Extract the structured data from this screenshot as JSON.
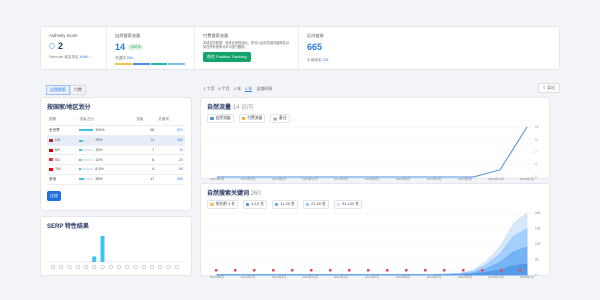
{
  "stats": {
    "authority": {
      "label": "Authority Score",
      "value": "2",
      "sub_prefix": "Semrush 域名排名",
      "sub_link": "6.6M ↑"
    },
    "organic": {
      "label": "自然搜索流量",
      "value": "14",
      "badge": "+267%",
      "sub_label": "关键词",
      "sub_value": "260 ↑",
      "bar_colors": [
        "#f5c24d",
        "#4a90e2",
        "#1fb8a9",
        "#7ac0f5"
      ]
    },
    "paid": {
      "label": "付费搜索流量",
      "desc": "本域名的数据，但未比较检测出，您可以启动关键词追踪并对其在所有竞争对手中进行跟踪。",
      "button": "前往 Position Tracking"
    },
    "backlinks": {
      "label": "反向链接",
      "value": "665",
      "sub_label": "引用域名",
      "sub_value": "235"
    }
  },
  "left_tabs": [
    "自然搜索",
    "付费"
  ],
  "country_panel": {
    "title": "按国家/地区划分",
    "headers": [
      "国家",
      "流量占比",
      "流量",
      "关键词"
    ],
    "rows": [
      {
        "flag": "",
        "country": "全世界",
        "share": "100%",
        "traffic": "48",
        "keywords": "531",
        "pct": 100,
        "hl": false,
        "flag_color": ""
      },
      {
        "flag": "US",
        "country": "US",
        "share": "29%",
        "traffic": "14",
        "keywords": "260",
        "pct": 29,
        "hl": true,
        "flag_color": "#b22234"
      },
      {
        "flag": "MY",
        "country": "MY",
        "share": "15%",
        "traffic": "7",
        "keywords": "11",
        "pct": 15,
        "hl": false,
        "flag_color": "#cc0001"
      },
      {
        "flag": "SG",
        "country": "SG",
        "share": "13%",
        "traffic": "6",
        "keywords": "20",
        "pct": 13,
        "hl": false,
        "flag_color": "#ef3340"
      },
      {
        "flag": "TW",
        "country": "TW",
        "share": "8.3%",
        "traffic": "4",
        "keywords": "84",
        "pct": 8,
        "hl": false,
        "flag_color": "#fe0000"
      },
      {
        "flag": "",
        "country": "其他",
        "share": "35%",
        "traffic": "17",
        "keywords": "255",
        "pct": 35,
        "hl": false,
        "flag_color": ""
      }
    ],
    "compare_btn": "比较"
  },
  "serp_panel": {
    "title": "SERP 特性结果",
    "bars": [
      0,
      0,
      0,
      0,
      0,
      3,
      14,
      0,
      0,
      0,
      0,
      0,
      0,
      0,
      0,
      0
    ]
  },
  "periods": [
    "1 个月",
    "6 个月",
    "1 年",
    "2 年",
    "全部时间"
  ],
  "period_active": 3,
  "export_label": "导出",
  "traffic_chart": {
    "title": "自然流量",
    "count": "14 访问",
    "legend": [
      {
        "label": "自然流量",
        "color": "#4a90e2"
      },
      {
        "label": "付费流量",
        "color": "#f5a623"
      },
      {
        "label": "备注",
        "color": ""
      }
    ],
    "x_labels": [
      "2023年5月",
      "2023年7月",
      "2023年9月",
      "2023年11月",
      "2024年1月",
      "2024年3月",
      "2024年5月",
      "2024年7月",
      "2024年9月",
      "2024年11月",
      "2025年1月"
    ],
    "y_labels": [
      "14",
      "11",
      "7",
      "4",
      "0"
    ],
    "values": [
      0,
      0,
      0,
      0,
      0,
      0,
      0,
      0,
      0,
      0,
      0,
      0,
      0,
      0,
      0,
      0,
      0,
      0,
      0,
      0,
      1,
      2,
      8,
      14
    ]
  },
  "keywords_chart": {
    "title": "自然搜索关键词",
    "count": "260",
    "legend": [
      {
        "label": "排名前 3 名",
        "color": "#f5c24d"
      },
      {
        "label": "4-10 名",
        "color": "#4a90e2"
      },
      {
        "label": "11-20 名",
        "color": "#5fa8f0"
      },
      {
        "label": "21-50 名",
        "color": "#8ec5ff"
      },
      {
        "label": "51-100 名",
        "color": "#c5def8"
      }
    ],
    "x_labels": [
      "2023年5月",
      "2023年7月",
      "2023年9月",
      "2023年11月",
      "2024年1月",
      "2024年3月",
      "2024年5月",
      "2024年7月",
      "2024年9月",
      "2024年11月",
      "2025年1月"
    ],
    "y_labels": [
      "264",
      "198",
      "132",
      "66",
      "0"
    ],
    "totals": [
      3,
      3,
      3,
      3,
      3,
      3,
      3,
      3,
      3,
      3,
      3,
      3,
      3,
      3,
      3,
      3,
      3,
      5,
      8,
      20,
      60,
      120,
      220,
      264
    ]
  }
}
